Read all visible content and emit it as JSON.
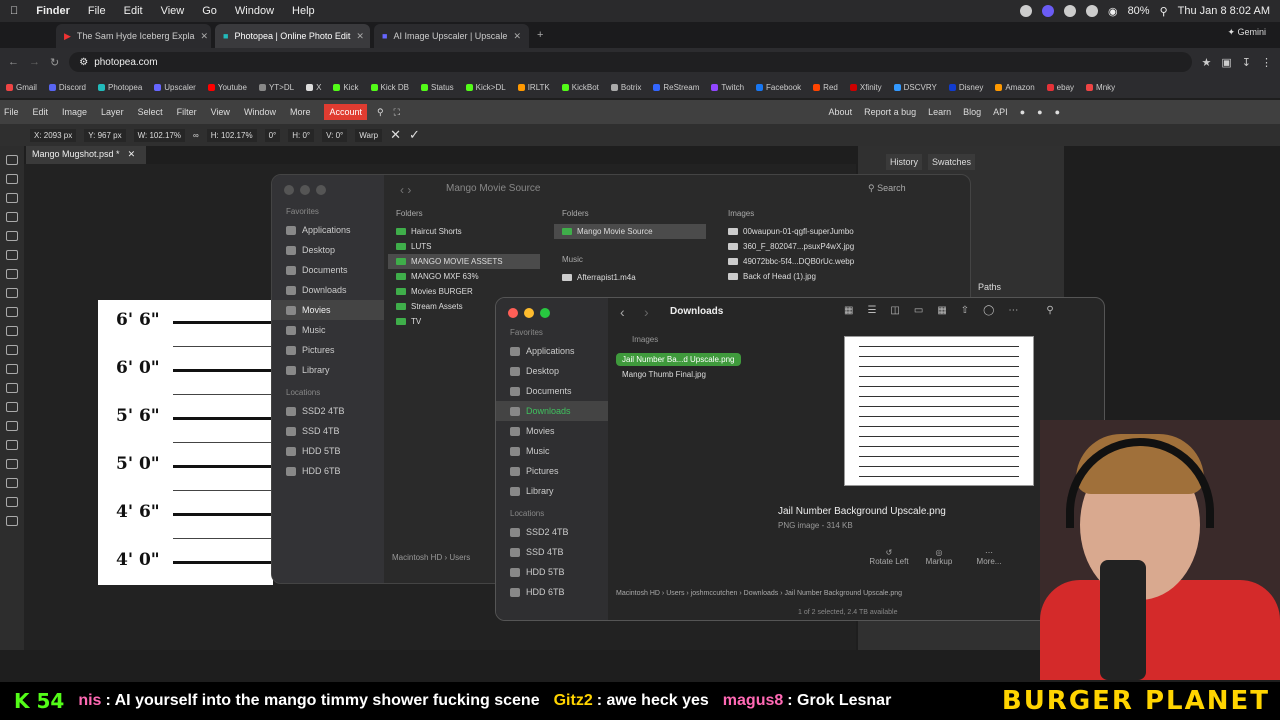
{
  "menubar": {
    "app": "Finder",
    "items": [
      "File",
      "Edit",
      "View",
      "Go",
      "Window",
      "Help"
    ],
    "datetime": "Thu Jan 8  8:02 AM",
    "battery": "80%"
  },
  "tabs": [
    {
      "label": "The Sam Hyde Iceberg Expla",
      "active": false
    },
    {
      "label": "Photopea | Online Photo Edit",
      "active": true
    },
    {
      "label": "AI Image Upscaler | Upscale",
      "active": false
    }
  ],
  "gemini": "Gemini",
  "url": "photopea.com",
  "bookmarks": [
    "Gmail",
    "Discord",
    "Photopea",
    "Upscaler",
    "Youtube",
    "YT>DL",
    "X",
    "Kick",
    "Kick DB",
    "Status",
    "Kick>DL",
    "IRLTK",
    "KickBot",
    "Botrix",
    "ReStream",
    "Twitch",
    "Facebook",
    "Red",
    "Xfinity",
    "DSCVRY",
    "Disney",
    "Amazon",
    "ebay",
    "Mnky"
  ],
  "photopea": {
    "menu": [
      "File",
      "Edit",
      "Image",
      "Layer",
      "Select",
      "Filter",
      "View",
      "Window",
      "More"
    ],
    "account": "Account",
    "right_links": [
      "About",
      "Report a bug",
      "Learn",
      "Blog",
      "API"
    ],
    "options": {
      "x": "X: 2093 px",
      "y": "Y: 967 px",
      "w": "W: 102.17%",
      "h": "H: 102.17%",
      "a": "0°",
      "hdeg": "H: 0°",
      "vdeg": "V: 0°",
      "warp": "Warp"
    },
    "doc_tab": "Mango Mugshot.psd *",
    "panel_tabs": [
      "History",
      "Swatches"
    ],
    "paths": "Paths",
    "heights": [
      "6' 6\"",
      "6' 0\"",
      "5' 6\"",
      "5' 0\"",
      "4' 6\"",
      "4' 0\""
    ]
  },
  "finder_back": {
    "title": "Mango Movie Source",
    "search": "Search",
    "favorites_label": "Favorites",
    "favorites": [
      "Applications",
      "Desktop",
      "Documents",
      "Downloads",
      "Movies",
      "Music",
      "Pictures",
      "Library"
    ],
    "locations_label": "Locations",
    "locations": [
      "SSD2 4TB",
      "SSD 4TB",
      "HDD 5TB",
      "HDD 6TB"
    ],
    "col1_header": "Folders",
    "col1": [
      "Haircut Shorts",
      "LUTS",
      "MANGO MOVIE ASSETS",
      "MANGO MXF 63%",
      "Movies BURGER",
      "Stream Assets",
      "TV"
    ],
    "col2_header": "Folders",
    "col2": [
      "Mango Movie Source"
    ],
    "col2_music_header": "Music",
    "col2_music": [
      "Afterrapist1.m4a"
    ],
    "col3_header": "Images",
    "col3": [
      "00waupun-01-qgfl-superJumbo",
      "360_F_802047...psuxP4wX.jpg",
      "49072bbc-5f4...DQB0rUc.webp",
      "Back of Head (1).jpg"
    ],
    "path": [
      "Macintosh HD",
      "Users"
    ]
  },
  "finder_front": {
    "title": "Downloads",
    "favorites_label": "Favorites",
    "favorites": [
      "Applications",
      "Desktop",
      "Documents",
      "Downloads",
      "Movies",
      "Music",
      "Pictures",
      "Library"
    ],
    "locations_label": "Locations",
    "locations": [
      "SSD2 4TB",
      "SSD 4TB",
      "HDD 5TB",
      "HDD 6TB"
    ],
    "images_header": "Images",
    "files": [
      "Jail Number Ba...d Upscale.png",
      "Mango Thumb Final.jpg"
    ],
    "preview_name": "Jail Number Background Upscale.png",
    "preview_meta": "PNG image - 314 KB",
    "actions": [
      "Rotate Left",
      "Markup",
      "More..."
    ],
    "path": [
      "Macintosh HD",
      "Users",
      "joshmccutchen",
      "Downloads",
      "Jail Number Background Upscale.png"
    ],
    "status": "1 of 2 selected, 2.4 TB available"
  },
  "ticker": {
    "count": "54",
    "messages": [
      {
        "user": "nis",
        "text": ": AI yourself into the mango timmy shower fucking scene"
      },
      {
        "user": "Gitz2",
        "text": ": awe heck yes"
      },
      {
        "user": "magus8",
        "text": ": Grok Lesnar"
      }
    ],
    "brand": "BURGER PLANET"
  }
}
